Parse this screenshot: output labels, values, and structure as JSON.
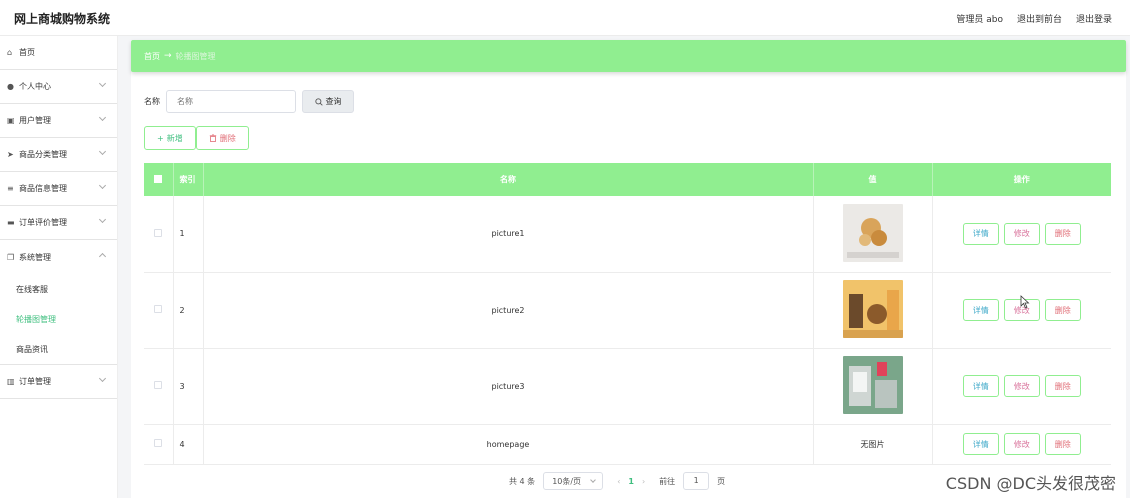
{
  "app": {
    "title": "网上商城购物系统"
  },
  "topbar": {
    "user": "管理员 abo",
    "to_front": "退出到前台",
    "logout": "退出登录"
  },
  "sidebar": {
    "items": [
      {
        "label": "首页",
        "icon": "home-icon",
        "glyph": "⌂"
      },
      {
        "label": "个人中心",
        "icon": "user-icon",
        "glyph": "●"
      },
      {
        "label": "用户管理",
        "icon": "users-icon",
        "glyph": "▣"
      },
      {
        "label": "商品分类管理",
        "icon": "send-icon",
        "glyph": "➤"
      },
      {
        "label": "商品信息管理",
        "icon": "list-icon",
        "glyph": "≡"
      },
      {
        "label": "订单评价管理",
        "icon": "monitor-icon",
        "glyph": "▬"
      },
      {
        "label": "系统管理",
        "icon": "copy-icon",
        "glyph": "❐"
      },
      {
        "label": "订单管理",
        "icon": "chart-icon",
        "glyph": "▥"
      }
    ],
    "system_sub": [
      "在线客服",
      "轮播图管理",
      "商品资讯"
    ]
  },
  "breadcrumb": {
    "home": "首页",
    "arrow": "→",
    "current": "轮播图管理"
  },
  "search": {
    "label": "名称",
    "placeholder": "名称",
    "button": "查询"
  },
  "actions": {
    "add": "新增",
    "delete": "删除"
  },
  "table": {
    "headers": {
      "index": "索引",
      "name": "名称",
      "value": "值",
      "ops": "操作"
    },
    "rows": [
      {
        "index": "1",
        "name": "picture1",
        "value": "",
        "image": "thumb-1"
      },
      {
        "index": "2",
        "name": "picture2",
        "value": "",
        "image": "thumb-2"
      },
      {
        "index": "3",
        "name": "picture3",
        "value": "",
        "image": "thumb-3"
      },
      {
        "index": "4",
        "name": "homepage",
        "value": "无图片",
        "image": ""
      }
    ],
    "ops": {
      "detail": "详情",
      "edit": "修改",
      "delete": "删除"
    }
  },
  "pager": {
    "total": "共 4 条",
    "page_size": "10条/页",
    "prev": "‹",
    "current": "1",
    "next": "›",
    "goto": "前往",
    "goto_value": "1",
    "page_unit": "页"
  },
  "watermark": "CSDN @DC头发很茂密",
  "colors": {
    "accent": "#90ee90",
    "active": "#3fbf7f"
  }
}
